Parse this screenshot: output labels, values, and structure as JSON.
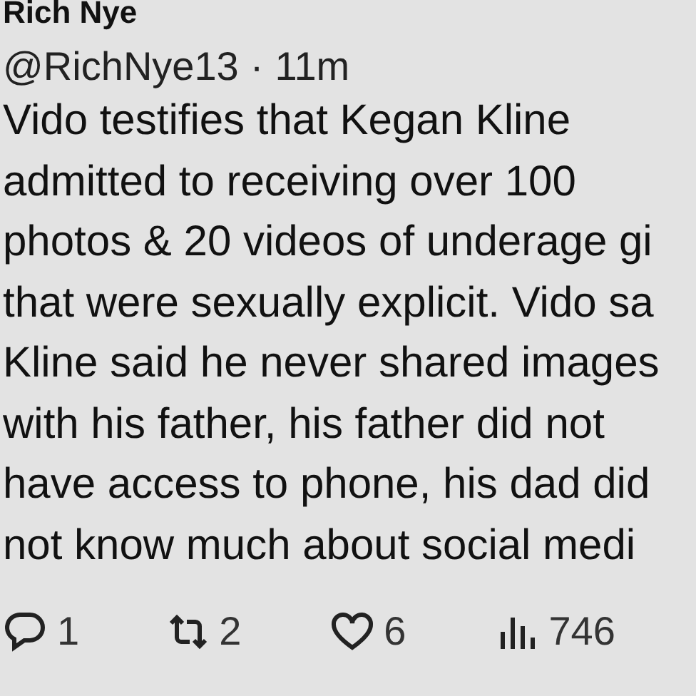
{
  "author": {
    "name": "Rich Nye",
    "handle": "@RichNye13",
    "separator": "·",
    "time": "11m"
  },
  "body_lines": [
    "Vido testifies that Kegan Kline",
    "admitted to receiving over 100",
    "photos & 20 videos of underage gi",
    "that were sexually explicit. Vido sa",
    "Kline said he never shared images",
    "with his father, his father did not",
    "have access to phone, his dad did",
    "not know much about social medi"
  ],
  "actions": [
    {
      "kind": "reply",
      "count": "1"
    },
    {
      "kind": "repost",
      "count": "2"
    },
    {
      "kind": "like",
      "count": "6"
    },
    {
      "kind": "views",
      "count": "746"
    }
  ]
}
